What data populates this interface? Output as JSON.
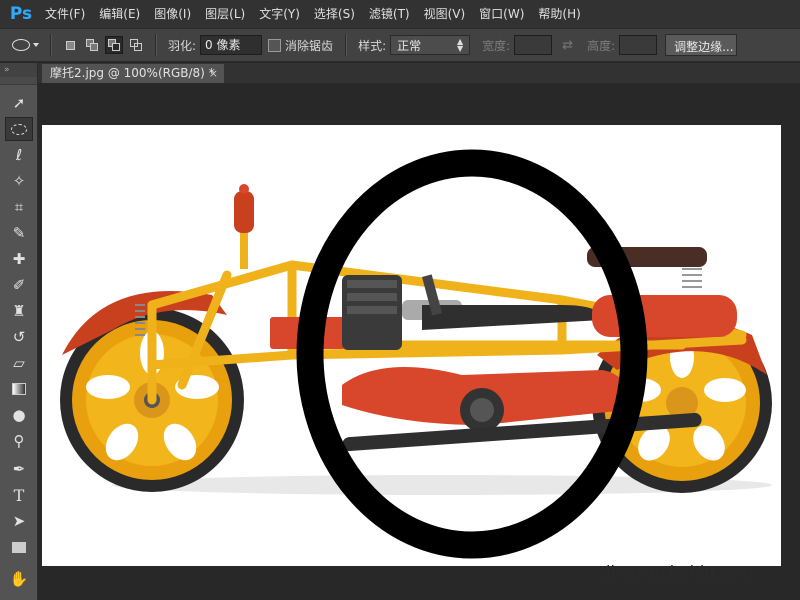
{
  "app": {
    "logo": "Ps"
  },
  "menu": [
    "文件(F)",
    "编辑(E)",
    "图像(I)",
    "图层(L)",
    "文字(Y)",
    "选择(S)",
    "滤镜(T)",
    "视图(V)",
    "窗口(W)",
    "帮助(H)"
  ],
  "options": {
    "feather_label": "羽化:",
    "feather_value": "0 像素",
    "antialias_label": "消除锯齿",
    "style_label": "样式:",
    "style_value": "正常",
    "width_label": "宽度:",
    "height_label": "高度:",
    "refine_button": "调整边缘..."
  },
  "toolbar": {
    "collapse": "»"
  },
  "document": {
    "tab_title": "摩托2.jpg @ 100%(RGB/8) *",
    "close": "×"
  },
  "watermark": {
    "logo": "Bai  经验",
    "url": "jingyan.baidu.com"
  },
  "colors": {
    "accent": "#31a8ff",
    "panel": "#535353",
    "menubar": "#323232",
    "canvas": "#ffffff"
  }
}
